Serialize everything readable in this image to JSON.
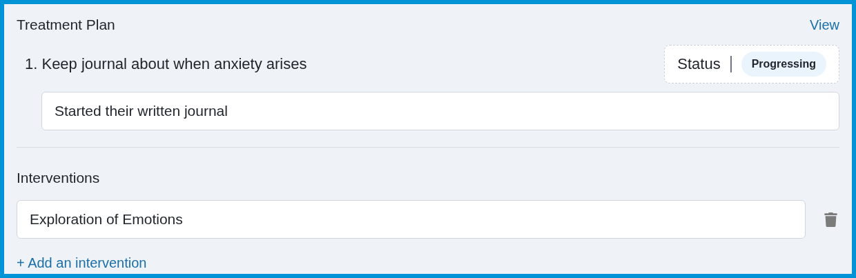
{
  "title": "Treatment Plan",
  "view_link": "View",
  "goals": [
    {
      "label": "1. Keep journal about when anxiety arises",
      "status_label": "Status",
      "status": "Progressing",
      "note": "Started their written journal"
    }
  ],
  "interventions": {
    "heading": "Interventions",
    "items": [
      {
        "value": "Exploration of Emotions"
      }
    ],
    "add_link": "+ Add an intervention"
  }
}
